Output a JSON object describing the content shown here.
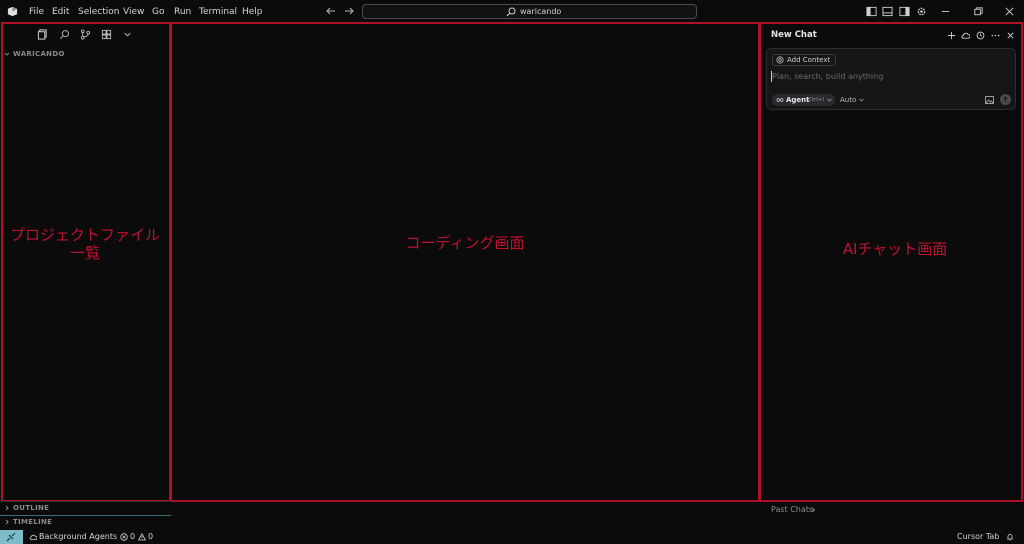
{
  "menu": [
    "File",
    "Edit",
    "Selection",
    "View",
    "Go",
    "Run",
    "Terminal",
    "Help"
  ],
  "search": {
    "text": "waricando"
  },
  "explorer": {
    "header": "WARICANDO"
  },
  "sections": {
    "outline": "OUTLINE",
    "timeline": "TIMELINE"
  },
  "annotations": {
    "project_files_line1": "プロジェクトファイル",
    "project_files_line2": "一覧",
    "coding_screen": "コーディング画面",
    "ai_chat_screen": "AIチャット画面"
  },
  "chat": {
    "title": "New Chat",
    "add_context": "Add Context",
    "placeholder": "Plan, search, build anything",
    "agent_label": "Agent",
    "agent_shortcut": "Ctrl+I",
    "model": "Auto",
    "past_chats": "Past Chats"
  },
  "statusbar": {
    "background_agents": "Background Agents",
    "errors": "0",
    "warnings": "0",
    "cursor_tab": "Cursor Tab"
  },
  "colors": {
    "annotation_red": "#b0102a",
    "remote_accent": "#7dbbc9",
    "background": "#0b0b0c"
  }
}
